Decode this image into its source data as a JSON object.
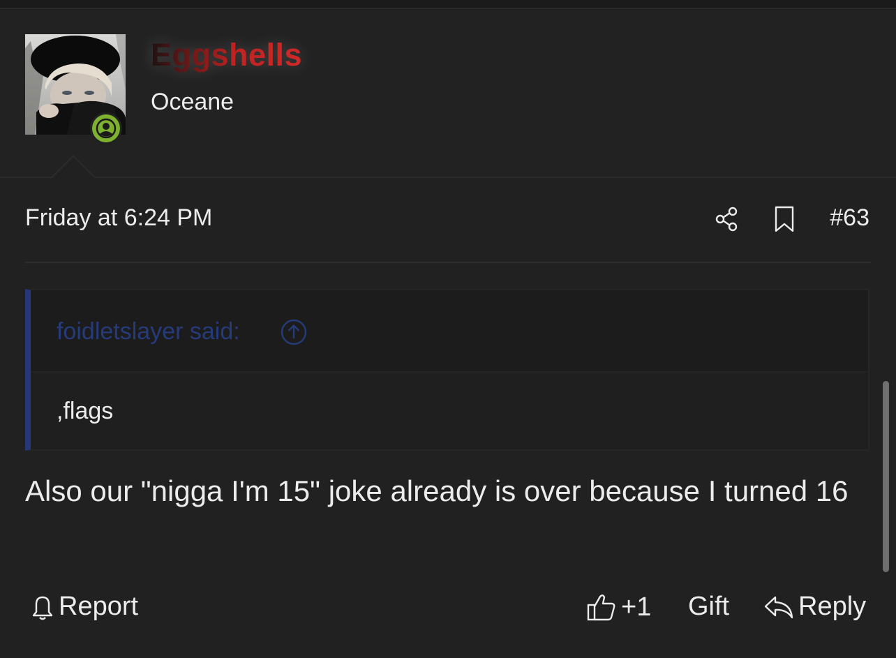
{
  "post": {
    "username": "Eggshells",
    "user_title": "Oceane",
    "timestamp": "Friday at 6:24 PM",
    "post_number": "#63",
    "quote": {
      "author_line": "foidletslayer said:",
      "text": ",flags"
    },
    "message": "Also our \"nigga I'm 15\" joke already is over because I turned 16",
    "actions": {
      "report": "Report",
      "like": "+1",
      "gift": "Gift",
      "reply": "Reply"
    }
  },
  "colors": {
    "background": "#212121",
    "online": "#7fb130",
    "quote_accent": "#263878",
    "username_red": "#c02222"
  }
}
